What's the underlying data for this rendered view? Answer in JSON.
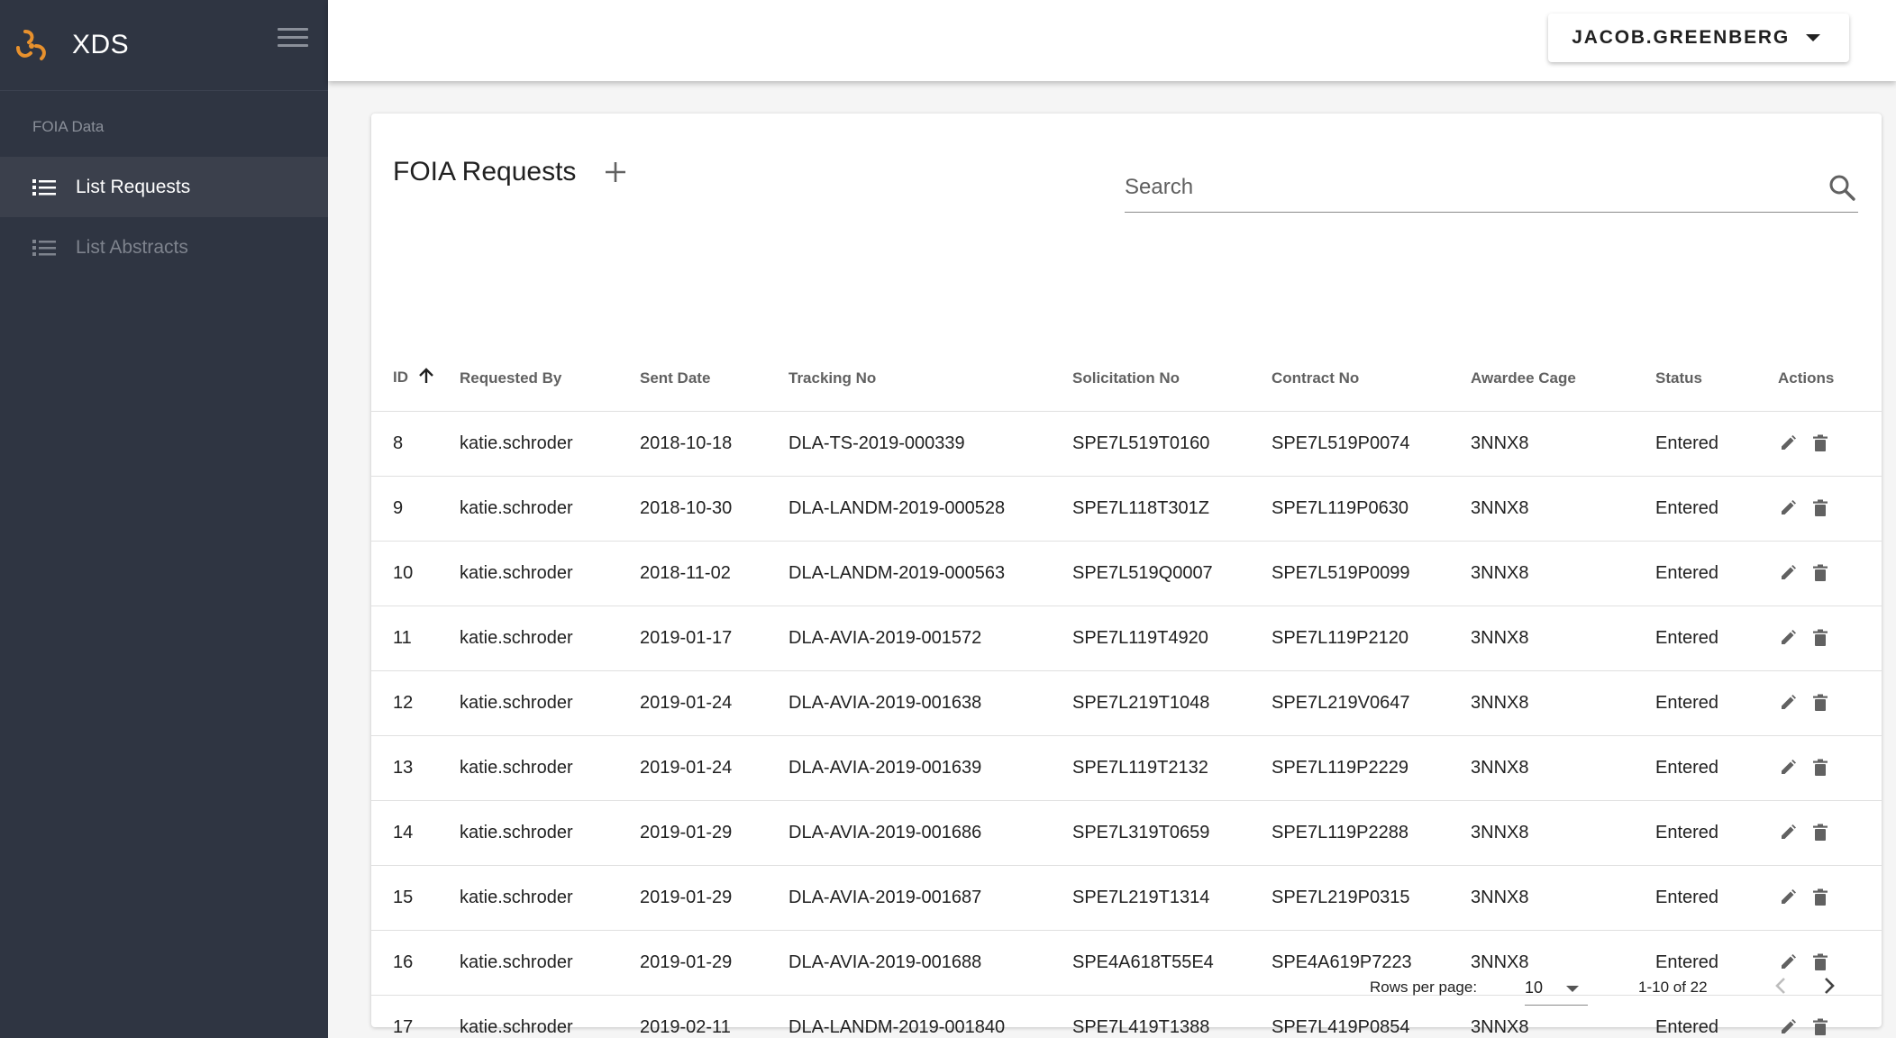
{
  "app": {
    "title": "XDS",
    "accent_color": "#e8912d",
    "sidebar_color": "#2f3542"
  },
  "sidebar": {
    "section_label": "FOIA Data",
    "items": [
      {
        "label": "List Requests",
        "icon": "list-icon",
        "active": true
      },
      {
        "label": "List Abstracts",
        "icon": "list-icon",
        "active": false
      }
    ]
  },
  "header": {
    "user_name": "JACOB.GREENBERG"
  },
  "card": {
    "title": "FOIA Requests",
    "search_placeholder": "Search"
  },
  "table": {
    "columns": [
      "ID",
      "Requested By",
      "Sent Date",
      "Tracking No",
      "Solicitation No",
      "Contract No",
      "Awardee Cage",
      "Status",
      "Actions"
    ],
    "sort_column": "ID",
    "sort_direction": "ascending",
    "rows": [
      [
        "8",
        "katie.schroder",
        "2018-10-18",
        "DLA-TS-2019-000339",
        "SPE7L519T0160",
        "SPE7L519P0074",
        "3NNX8",
        "Entered"
      ],
      [
        "9",
        "katie.schroder",
        "2018-10-30",
        "DLA-LANDM-2019-000528",
        "SPE7L118T301Z",
        "SPE7L119P0630",
        "3NNX8",
        "Entered"
      ],
      [
        "10",
        "katie.schroder",
        "2018-11-02",
        "DLA-LANDM-2019-000563",
        "SPE7L519Q0007",
        "SPE7L519P0099",
        "3NNX8",
        "Entered"
      ],
      [
        "11",
        "katie.schroder",
        "2019-01-17",
        "DLA-AVIA-2019-001572",
        "SPE7L119T4920",
        "SPE7L119P2120",
        "3NNX8",
        "Entered"
      ],
      [
        "12",
        "katie.schroder",
        "2019-01-24",
        "DLA-AVIA-2019-001638",
        "SPE7L219T1048",
        "SPE7L219V0647",
        "3NNX8",
        "Entered"
      ],
      [
        "13",
        "katie.schroder",
        "2019-01-24",
        "DLA-AVIA-2019-001639",
        "SPE7L119T2132",
        "SPE7L119P2229",
        "3NNX8",
        "Entered"
      ],
      [
        "14",
        "katie.schroder",
        "2019-01-29",
        "DLA-AVIA-2019-001686",
        "SPE7L319T0659",
        "SPE7L119P2288",
        "3NNX8",
        "Entered"
      ],
      [
        "15",
        "katie.schroder",
        "2019-01-29",
        "DLA-AVIA-2019-001687",
        "SPE7L219T1314",
        "SPE7L219P0315",
        "3NNX8",
        "Entered"
      ],
      [
        "16",
        "katie.schroder",
        "2019-01-29",
        "DLA-AVIA-2019-001688",
        "SPE4A618T55E4",
        "SPE4A619P7223",
        "3NNX8",
        "Entered"
      ],
      [
        "17",
        "katie.schroder",
        "2019-02-11",
        "DLA-LANDM-2019-001840",
        "SPE7L419T1388",
        "SPE7L419P0854",
        "3NNX8",
        "Entered"
      ]
    ],
    "row_actions": [
      "edit-icon",
      "delete-icon"
    ]
  },
  "pagination": {
    "rows_per_page_label": "Rows per page:",
    "rows_per_page": "10",
    "range": "1-10 of 22"
  }
}
